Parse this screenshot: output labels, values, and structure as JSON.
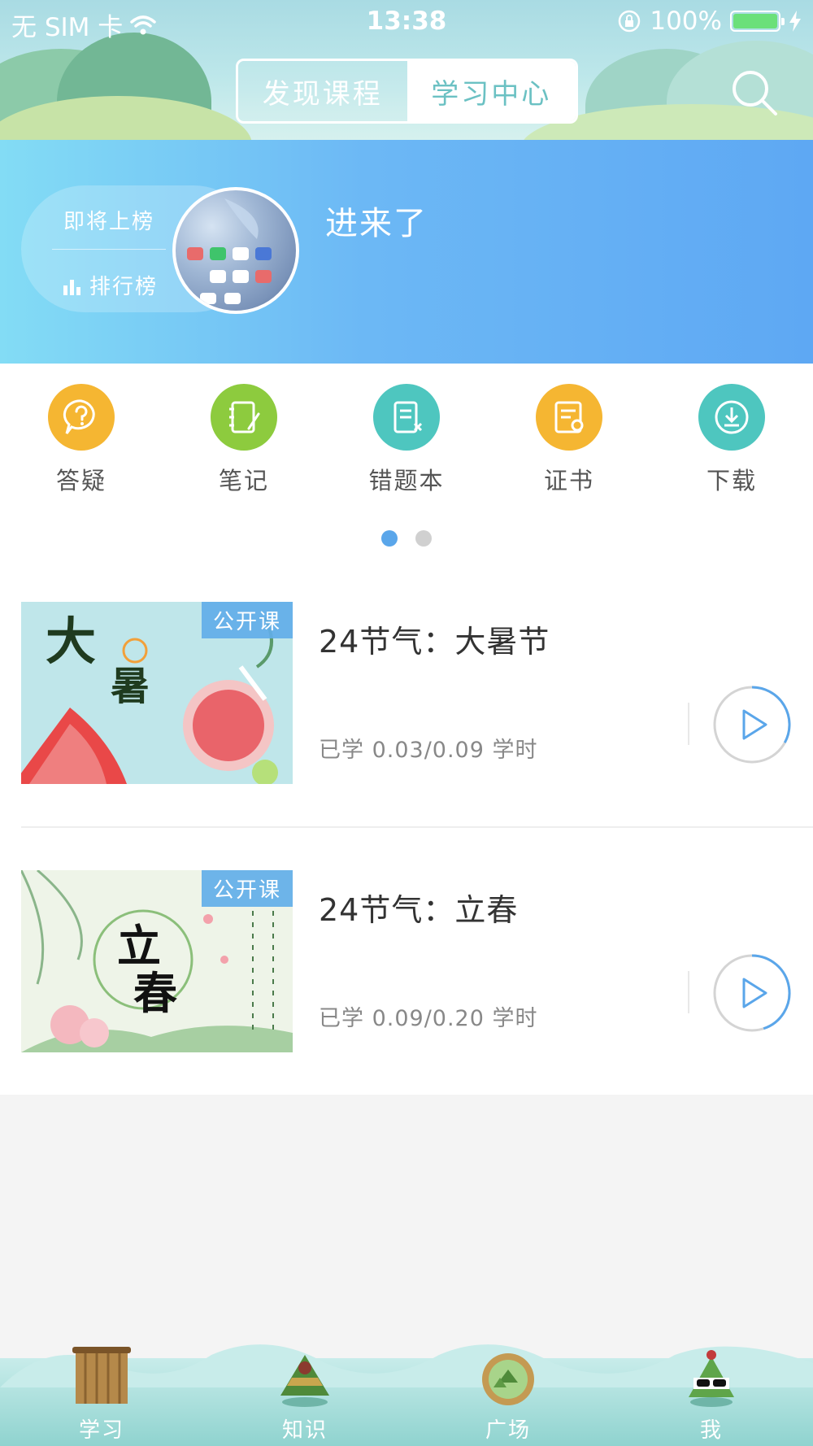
{
  "status_bar": {
    "carrier": "无 SIM 卡",
    "time": "13:38",
    "battery": "100%",
    "battery_level": 1.0
  },
  "header": {
    "tabs": [
      {
        "label": "发现课程",
        "active": false
      },
      {
        "label": "学习中心",
        "active": true
      }
    ]
  },
  "banner": {
    "rank_status": "即将上榜",
    "rank_label": "排行榜",
    "username": "进来了"
  },
  "features": [
    {
      "label": "答疑",
      "icon": "question-bubble-icon",
      "color": "#f5b632"
    },
    {
      "label": "笔记",
      "icon": "notebook-icon",
      "color": "#8dcb3e"
    },
    {
      "label": "错题本",
      "icon": "wrong-book-icon",
      "color": "#4ec6bf"
    },
    {
      "label": "证书",
      "icon": "certificate-icon",
      "color": "#f5b632"
    },
    {
      "label": "下载",
      "icon": "download-icon",
      "color": "#4ec6bf"
    }
  ],
  "pager": {
    "pages": 2,
    "current": 1,
    "active_color": "#5aa6ea",
    "inactive_color": "#d0d0d0"
  },
  "courses": [
    {
      "badge": "公开课",
      "title": "24节气：大暑节",
      "progress": "已学 0.03/0.09 学时",
      "completed_fraction": 0.33
    },
    {
      "badge": "公开课",
      "title": "24节气：立春",
      "progress": "已学 0.09/0.20 学时",
      "completed_fraction": 0.45
    }
  ],
  "tabbar": {
    "items": [
      {
        "label": "学习",
        "icon": "scroll-icon",
        "active": true
      },
      {
        "label": "知识",
        "icon": "zongzi-icon",
        "active": false
      },
      {
        "label": "广场",
        "icon": "steamer-icon",
        "active": false
      },
      {
        "label": "我",
        "icon": "zongzi-mascot-icon",
        "active": false
      }
    ]
  },
  "colors": {
    "teal": "#6bc1c3",
    "banner_blue": "#5ea8f3",
    "accent_blue": "#5aa6ea"
  }
}
